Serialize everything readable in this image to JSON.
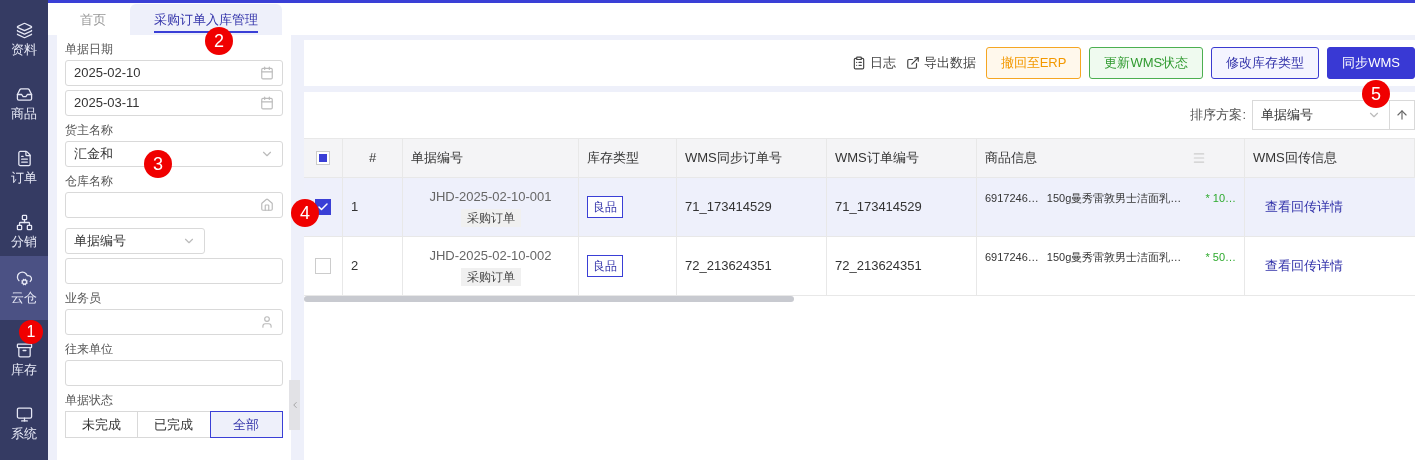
{
  "sidebar": {
    "items": [
      {
        "label": "资料",
        "selected": false
      },
      {
        "label": "商品",
        "selected": false
      },
      {
        "label": "订单",
        "selected": false
      },
      {
        "label": "分销",
        "selected": false
      },
      {
        "label": "云仓",
        "selected": true
      },
      {
        "label": "库存",
        "selected": false
      },
      {
        "label": "系统",
        "selected": false
      }
    ]
  },
  "tabs": [
    {
      "label": "首页",
      "selected": false
    },
    {
      "label": "采购订单入库管理",
      "selected": true
    }
  ],
  "filters": {
    "date": {
      "label": "单据日期",
      "values": [
        "2025-02-10",
        "2025-03-11"
      ]
    },
    "owner": {
      "label": "货主名称",
      "value": "汇金和"
    },
    "warehouse": {
      "label": "仓库名称"
    },
    "doc_field": {
      "value": "单据编号"
    },
    "salesperson": {
      "label": "业务员"
    },
    "partner": {
      "label": "往来单位"
    },
    "status": {
      "label": "单据状态",
      "options": [
        {
          "label": "未完成",
          "selected": false
        },
        {
          "label": "已完成",
          "selected": false
        },
        {
          "label": "全部",
          "selected": true
        }
      ]
    }
  },
  "toolbar": {
    "links": [
      {
        "label": "日志"
      },
      {
        "label": "导出数据"
      }
    ],
    "buttons": [
      {
        "label": "撤回至ERP",
        "kind": "warning"
      },
      {
        "label": "更新WMS状态",
        "kind": "success"
      },
      {
        "label": "修改库存类型",
        "kind": "outline"
      },
      {
        "label": "同步WMS",
        "kind": "primary"
      }
    ]
  },
  "sort": {
    "label": "排序方案:",
    "value": "单据编号"
  },
  "table": {
    "select_all_indeterminate": true,
    "columns": [
      "#",
      "单据编号",
      "库存类型",
      "WMS同步订单号",
      "WMS订单编号",
      "商品信息",
      "WMS回传信息"
    ],
    "rows": [
      {
        "selected": true,
        "number": "1",
        "doc_no": "JHD-2025-02-10-001",
        "doc_type": "采购订单",
        "stock_type": "良品",
        "wms_sync_no": "71_173414529",
        "wms_order_no": "71_173414529",
        "product_code": "6917246…",
        "product_name": "150g曼秀雷敦男士洁面乳…",
        "quantity": "* 10…",
        "action": "查看回传详情"
      },
      {
        "selected": false,
        "number": "2",
        "doc_no": "JHD-2025-02-10-002",
        "doc_type": "采购订单",
        "stock_type": "良品",
        "wms_sync_no": "72_213624351",
        "wms_order_no": "72_213624351",
        "product_code": "6917246…",
        "product_name": "150g曼秀雷敦男士洁面乳…",
        "quantity": "* 50…",
        "action": "查看回传详情"
      }
    ]
  },
  "annotations": [
    "1",
    "2",
    "3",
    "4",
    "5"
  ]
}
